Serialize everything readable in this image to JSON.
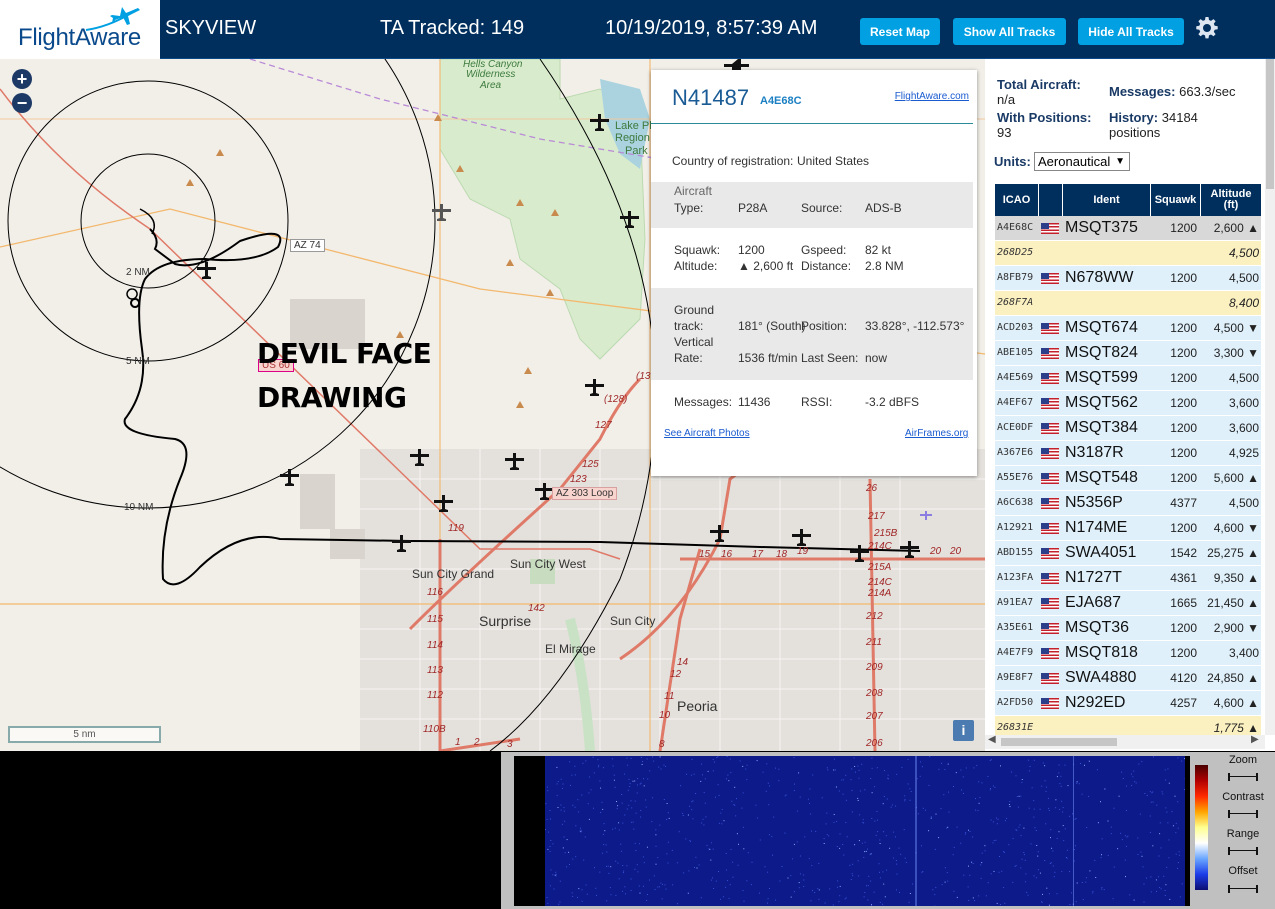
{
  "header": {
    "logo_text": "FlightAware",
    "app_name": "SKYVIEW",
    "tracked_label": "TA Tracked: 149",
    "datetime": "10/19/2019, 8:57:39 AM",
    "buttons": {
      "reset_map": "Reset Map",
      "show_all": "Show All Tracks",
      "hide_all": "Hide All Tracks"
    },
    "colors": {
      "bar": "#002f5d",
      "button": "#00a0e2"
    }
  },
  "map": {
    "zoom_in": "+",
    "zoom_out": "−",
    "annotation_line1": "DEVIL FACE",
    "annotation_line2": "DRAWING",
    "range_rings": [
      "2 NM",
      "5 NM",
      "10 NM"
    ],
    "places": [
      "Hells Canyon",
      "Wilderness",
      "Area",
      "Lake Plea",
      "Region",
      "Park",
      "AZ 74",
      "US 60",
      "AZ 303 Loop",
      "Sun City Grand",
      "Sun City West",
      "Surprise",
      "Sun City",
      "El Mirage",
      "Peoria"
    ],
    "route_numbers": [
      "(128)",
      "127",
      "125",
      "123",
      "119",
      "116",
      "115",
      "114",
      "113",
      "112",
      "110B",
      "142",
      "14",
      "12",
      "11",
      "10",
      "9",
      "8",
      "15",
      "16",
      "17",
      "18",
      "19",
      "20",
      "26",
      "217",
      "215B",
      "214C",
      "215A",
      "214C",
      "214A",
      "212",
      "211",
      "209",
      "208",
      "207",
      "206",
      "1",
      "2",
      "3",
      "(13"
    ],
    "scale_label": "5 nm",
    "info_icon": "i"
  },
  "popup": {
    "registration": "N41487",
    "hex": "A4E68C",
    "fa_link": "FlightAware.com",
    "country_label": "Country of registration:",
    "country_value": "United States",
    "aircraft_type_label": "Aircraft Type:",
    "aircraft_type_label_l1": "Aircraft",
    "aircraft_type_label_l2": "Type:",
    "aircraft_type": "P28A",
    "source_label": "Source:",
    "source": "ADS-B",
    "squawk_label": "Squawk:",
    "squawk": "1200",
    "gspeed_label": "Gspeed:",
    "gspeed": "82 kt",
    "altitude_label": "Altitude:",
    "altitude": "▲ 2,600 ft",
    "distance_label": "Distance:",
    "distance": "2.8 NM",
    "ground_track_label_l1": "Ground",
    "ground_track_label_l2": "track:",
    "ground_track": "181° (South)",
    "position_label": "Position:",
    "position": "33.828°, -112.573°",
    "vrate_label_l1": "Vertical",
    "vrate_label_l2": "Rate:",
    "vrate": "1536 ft/min",
    "last_seen_label": "Last Seen:",
    "last_seen": "now",
    "messages_label": "Messages:",
    "messages": "11436",
    "rssi_label": "RSSI:",
    "rssi": "-3.2 dBFS",
    "photos_link": "See Aircraft Photos",
    "airframes_link": "AirFrames.org"
  },
  "panel": {
    "total_aircraft_label": "Total Aircraft:",
    "total_aircraft": "n/a",
    "with_positions_label": "With Positions:",
    "with_positions": "93",
    "messages_label": "Messages:",
    "messages": "663.3/sec",
    "history_label": "History:",
    "history": "34184",
    "history_unit": "positions",
    "units_label": "Units:",
    "units_value": "Aeronautical",
    "columns": [
      "ICAO",
      "",
      "Ident",
      "Squawk",
      "Altitude (ft)"
    ],
    "col_alt_l1": "Altitude",
    "col_alt_l2": "(ft)",
    "rows": [
      {
        "icao": "A4E68C",
        "flag": true,
        "ident": "MSQT375",
        "squawk": "1200",
        "alt": "2,600 ▲",
        "style": "selected"
      },
      {
        "icao": "268D25",
        "flag": false,
        "ident": "",
        "squawk": "",
        "alt": "4,500",
        "style": "yellow"
      },
      {
        "icao": "A8FB79",
        "flag": true,
        "ident": "N678WW",
        "squawk": "1200",
        "alt": "4,500",
        "style": "blue"
      },
      {
        "icao": "268F7A",
        "flag": false,
        "ident": "",
        "squawk": "",
        "alt": "8,400",
        "style": "yellow"
      },
      {
        "icao": "ACD203",
        "flag": true,
        "ident": "MSQT674",
        "squawk": "1200",
        "alt": "4,500 ▼",
        "style": "blue"
      },
      {
        "icao": "ABE105",
        "flag": true,
        "ident": "MSQT824",
        "squawk": "1200",
        "alt": "3,300 ▼",
        "style": "blue"
      },
      {
        "icao": "A4E569",
        "flag": true,
        "ident": "MSQT599",
        "squawk": "1200",
        "alt": "4,500",
        "style": "blue"
      },
      {
        "icao": "A4EF67",
        "flag": true,
        "ident": "MSQT562",
        "squawk": "1200",
        "alt": "3,600",
        "style": "blue"
      },
      {
        "icao": "ACE0DF",
        "flag": true,
        "ident": "MSQT384",
        "squawk": "1200",
        "alt": "3,600",
        "style": "blue"
      },
      {
        "icao": "A367E6",
        "flag": true,
        "ident": "N3187R",
        "squawk": "1200",
        "alt": "4,925",
        "style": "blue"
      },
      {
        "icao": "A55E76",
        "flag": true,
        "ident": "MSQT548",
        "squawk": "1200",
        "alt": "5,600 ▲",
        "style": "blue"
      },
      {
        "icao": "A6C638",
        "flag": true,
        "ident": "N5356P",
        "squawk": "4377",
        "alt": "4,500",
        "style": "blue"
      },
      {
        "icao": "A12921",
        "flag": true,
        "ident": "N174ME",
        "squawk": "1200",
        "alt": "4,600 ▼",
        "style": "blue"
      },
      {
        "icao": "ABD155",
        "flag": true,
        "ident": "SWA4051",
        "squawk": "1542",
        "alt": "25,275 ▲",
        "style": "blue"
      },
      {
        "icao": "A123FA",
        "flag": true,
        "ident": "N1727T",
        "squawk": "4361",
        "alt": "9,350 ▲",
        "style": "blue"
      },
      {
        "icao": "A91EA7",
        "flag": true,
        "ident": "EJA687",
        "squawk": "1665",
        "alt": "21,450 ▲",
        "style": "blue"
      },
      {
        "icao": "A35E61",
        "flag": true,
        "ident": "MSQT36",
        "squawk": "1200",
        "alt": "2,900 ▼",
        "style": "blue"
      },
      {
        "icao": "A4E7F9",
        "flag": true,
        "ident": "MSQT818",
        "squawk": "1200",
        "alt": "3,400",
        "style": "blue"
      },
      {
        "icao": "A9E8F7",
        "flag": true,
        "ident": "SWA4880",
        "squawk": "4120",
        "alt": "24,850 ▲",
        "style": "blue"
      },
      {
        "icao": "A2FD50",
        "flag": true,
        "ident": "N292ED",
        "squawk": "4257",
        "alt": "4,600 ▲",
        "style": "blue"
      },
      {
        "icao": "26831E",
        "flag": false,
        "ident": "",
        "squawk": "",
        "alt": "1,775 ▲",
        "style": "yellow"
      }
    ],
    "row_colors": {
      "selected": "#d8d8d8",
      "yellow": "#fbf0c0",
      "blue": "#dff0fb"
    }
  },
  "waterfall": {
    "labels": [
      "Zoom",
      "Contrast",
      "Range",
      "Offset"
    ]
  }
}
